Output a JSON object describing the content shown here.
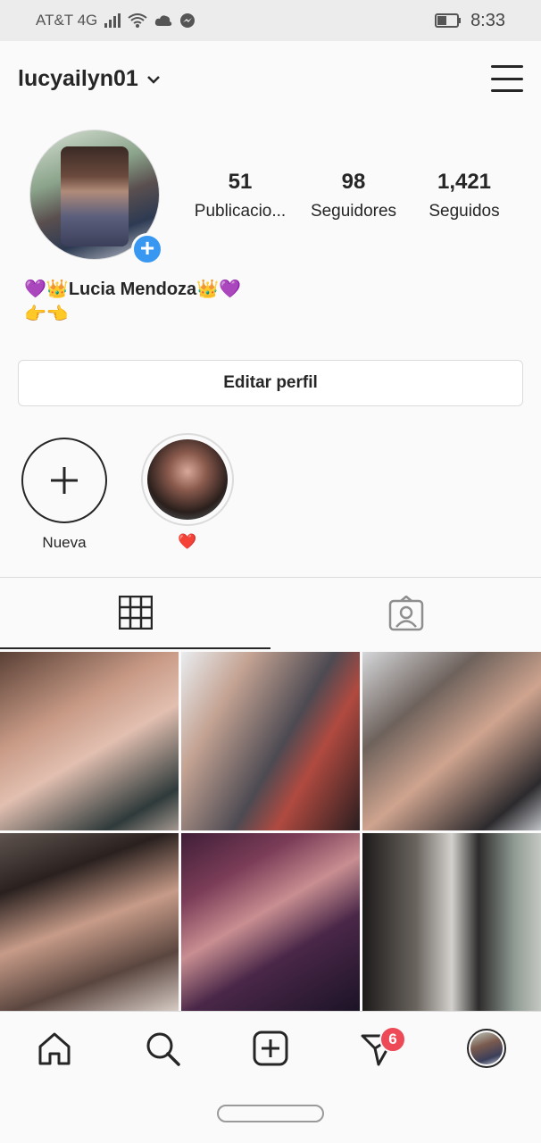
{
  "status_bar": {
    "carrier": "AT&T 4G",
    "time": "8:33"
  },
  "header": {
    "username": "lucyailyn01"
  },
  "stats": [
    {
      "value": "51",
      "label": "Publicacio..."
    },
    {
      "value": "98",
      "label": "Seguidores"
    },
    {
      "value": "1,421",
      "label": "Seguidos"
    }
  ],
  "bio": {
    "name": "Lucia Mendoza",
    "heart_glyph": "💜",
    "crown_glyph": "👑",
    "hands_glyph": "👉👈"
  },
  "edit_profile_label": "Editar perfil",
  "highlights": [
    {
      "label": "Nueva"
    },
    {
      "label": "❤️"
    }
  ],
  "badges": {
    "direct_count": "6"
  },
  "colors": {
    "accent": "#3897f0",
    "badge": "#ed4956",
    "text": "#262626",
    "border": "#dbdbdb"
  },
  "icons": {
    "grid_tab": "grid-icon",
    "tagged_tab": "tagged-person-icon",
    "nav": [
      "home-icon",
      "search-icon",
      "add-post-icon",
      "direct-icon",
      "profile-icon"
    ]
  }
}
